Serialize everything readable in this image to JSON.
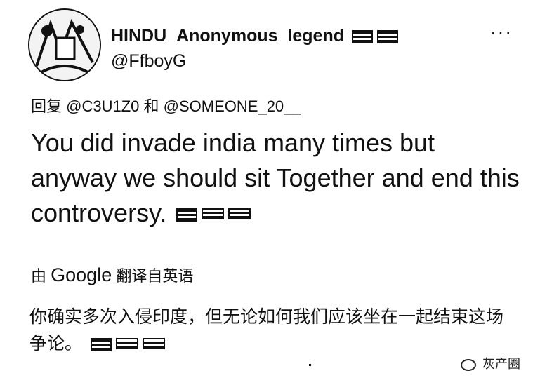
{
  "tweet": {
    "author_name": "HINDU_Anonymous_legend",
    "author_handle": "@FfboyG",
    "more_label": "···",
    "reply_prefix": "回复",
    "reply_user_1": "@C3U1Z0",
    "reply_conjunction": "和",
    "reply_user_2": "@SOMEONE_20__",
    "text": "You did invade india many times but anyway we should sit Together and end this controversy.",
    "translated_by_prefix": "由",
    "translated_by_service": "Google",
    "translated_by_suffix": "翻译自英语",
    "translation_text": "你确实多次入侵印度，但无论如何我们应该坐在一起结束这场争论。"
  },
  "watermark": {
    "text": "灰产圈",
    "icon": "wechat-icon"
  },
  "icons": {
    "avatar": "avatar-image",
    "flags": [
      "india-flag-icon",
      "flag-icon",
      "flag-icon"
    ]
  }
}
